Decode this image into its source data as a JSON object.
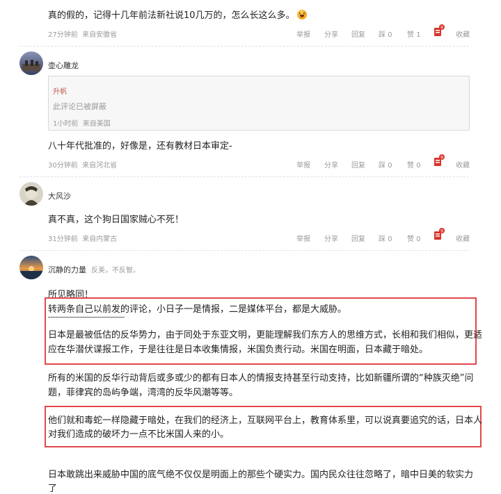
{
  "comment1": {
    "text": "真的假的，记得十几年前法新社说10几万的，怎么长这么多。",
    "time": "27分钟前",
    "location": "来自安徽省",
    "report": "举报",
    "share": "分享",
    "reply": "回复",
    "dislike_label": "踩",
    "dislike_count": "0",
    "like_label": "赞",
    "like_count": "1",
    "badge": "9",
    "collect": "收藏"
  },
  "comment2": {
    "username": "壶心雕龙",
    "quote_user": "升帆",
    "quote_text": "此评论已被屏蔽",
    "quote_time": "1小时前",
    "quote_location": "来自美国",
    "text": "八十年代批准的，好像是，还有教材日本审定-",
    "time": "30分钟前",
    "location": "来自河北省",
    "report": "举报",
    "share": "分享",
    "reply": "回复",
    "dislike_label": "踩",
    "dislike_count": "0",
    "like_label": "赞",
    "like_count": "0",
    "badge": "9",
    "collect": "收藏"
  },
  "comment3": {
    "username": "大风沙",
    "text": "真不真，这个狗日国家贼心不死！",
    "time": "31分钟前",
    "location": "来自内蒙古",
    "report": "举报",
    "share": "分享",
    "reply": "回复",
    "dislike_label": "踩",
    "dislike_count": "0",
    "like_label": "赞",
    "like_count": "0",
    "badge": "9",
    "collect": "收藏"
  },
  "comment4": {
    "username": "沉静的力量",
    "bio": "反美，不反智。",
    "p1": "所见略同！",
    "box1_l1": "转两条自己以前发的评论，小日子一是情报，二是媒体平台，都是大威胁。",
    "box1_l2": "日本是最被低估的反华势力，由于同处于东亚文明，更能理解我们东方人的思维方式，长相和我们相似，更适",
    "box1_l3": "应在华潜伏谍报工作，于是往往是日本收集情报，米国负责行动。米国在明面，日本藏于暗处。",
    "p2_l1": "所有的米国的反华行动背后或多或少的都有日本人的情报支持甚至行动支持，比如新疆所谓的“种族灭绝”问",
    "p2_l2": "题，菲律宾的岛屿争端，湾湾的反华风潮等等。",
    "box2_l1": "他们就和毒蛇一样隐藏于暗处，在我们的经济上，互联网平台上，教育体系里，可以说真要追究的话，日本人",
    "box2_l2": "对我们造成的破坏力一点不比米国人来的小。",
    "p3_l1": "日本敢跳出来威胁中国的底气绝不仅仅是明面上的那些个硬实力。国内民众往往忽略了，暗中日美的软实力",
    "p3_l2": "了"
  },
  "colors": {
    "highlight_border": "#e2474b",
    "meta_text": "#9a9a9a",
    "badge_red": "#d8342c"
  }
}
